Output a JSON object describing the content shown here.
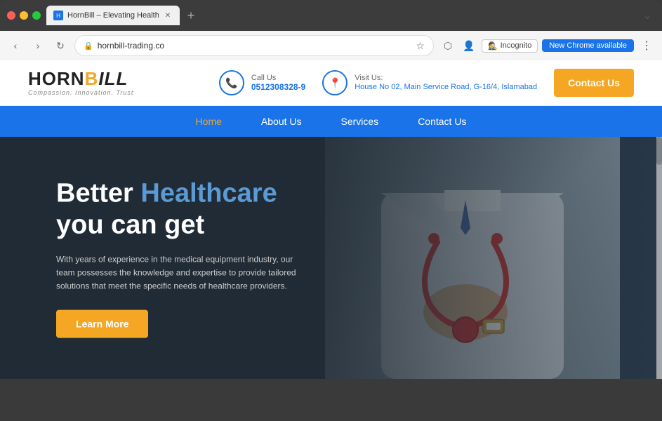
{
  "browser": {
    "tab_title": "HornBill – Elevating Healthca...",
    "url": "hornbill-trading.co",
    "new_tab_btn": "+",
    "back_btn": "‹",
    "forward_btn": "›",
    "reload_btn": "↻",
    "incognito_label": "Incognito",
    "new_chrome_label": "New Chrome available",
    "more_label": "⋮"
  },
  "header": {
    "logo_horn": "HORN",
    "logo_b": "B",
    "logo_ill": "ILL",
    "logo_tagline": "Compassion. Innovation. Trust",
    "call_us_label": "Call Us",
    "call_us_number": "0512308328-9",
    "visit_us_label": "Visit Us:",
    "visit_us_address": "House No 02, Main Service Road, G-16/4, Islamabad",
    "contact_btn": "Contact Us"
  },
  "nav": {
    "items": [
      {
        "label": "Home",
        "active": true
      },
      {
        "label": "About Us",
        "active": false
      },
      {
        "label": "Services",
        "active": false
      },
      {
        "label": "Contact Us",
        "active": false
      }
    ]
  },
  "hero": {
    "title_part1": "Better ",
    "title_highlight": "Healthcare",
    "title_part2": "you can get",
    "description": "With years of experience in the medical equipment industry, our team possesses the knowledge and expertise to provide tailored solutions that meet the specific needs of healthcare providers.",
    "learn_more_btn": "Learn More"
  }
}
